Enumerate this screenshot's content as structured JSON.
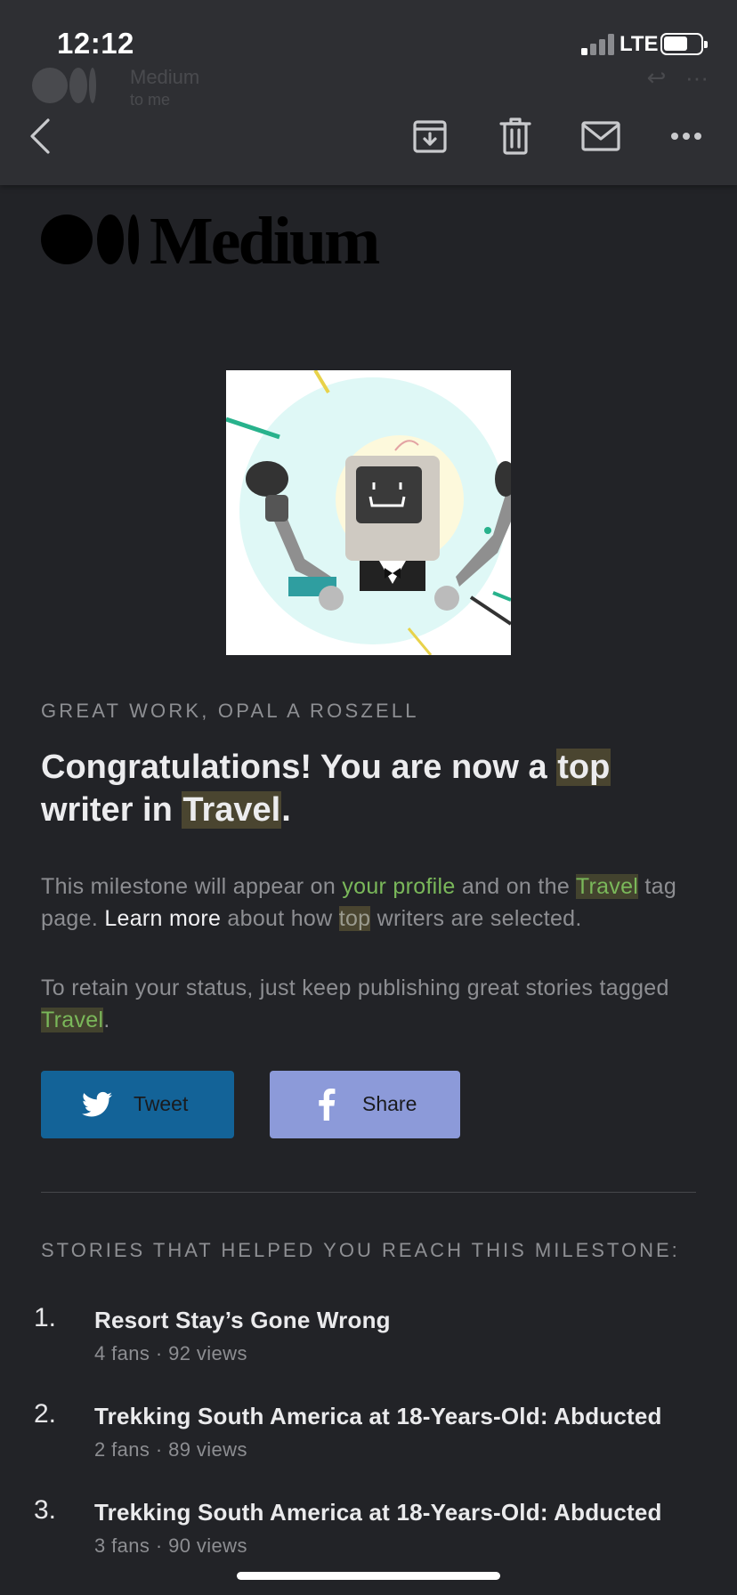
{
  "status_bar": {
    "time": "12:12",
    "network": "LTE"
  },
  "ghost_sender": {
    "name": "Medium",
    "meta": "to me"
  },
  "toolbar": {
    "icons": [
      "back-icon",
      "archive-icon",
      "trash-icon",
      "mail-icon",
      "more-icon"
    ]
  },
  "email": {
    "logo_text": "Medium",
    "eyebrow": "GREAT WORK, OPAL A ROSZELL",
    "headline": {
      "part1": "Congratulations! You are now a ",
      "highlight1": "top",
      "part2": " writer in ",
      "highlight2": "Travel",
      "part3": "."
    },
    "paragraph1": {
      "t1": "This milestone will appear on ",
      "link_profile": "your profile",
      "t2": " and on the ",
      "tag": "Travel",
      "t3": " tag page. ",
      "link_learn": "Learn more",
      "t4": " about how ",
      "top": "top",
      "t5": " writers are selected."
    },
    "paragraph2": {
      "t1": "To retain your status, just keep publishing great stories tagged ",
      "tag": "Travel",
      "t2": "."
    },
    "buttons": {
      "tweet_label": "Tweet",
      "share_label": "Share"
    },
    "stories_title": "STORIES THAT HELPED YOU REACH THIS MILESTONE:",
    "stories": [
      {
        "num": "1.",
        "title": "Resort Stay’s Gone Wrong",
        "meta": "4 fans · 92 views"
      },
      {
        "num": "2.",
        "title": "Trekking South America at 18-Years-Old: Abducted",
        "meta": "2 fans · 89 views"
      },
      {
        "num": "3.",
        "title": "Trekking South America at 18-Years-Old: Abducted",
        "meta": "3 fans · 90 views"
      }
    ]
  },
  "colors": {
    "background": "#222327",
    "toolbar": "#2e2f33",
    "tweet": "#136398",
    "share": "#8c9ad9",
    "accent_green": "#7ab85a"
  }
}
